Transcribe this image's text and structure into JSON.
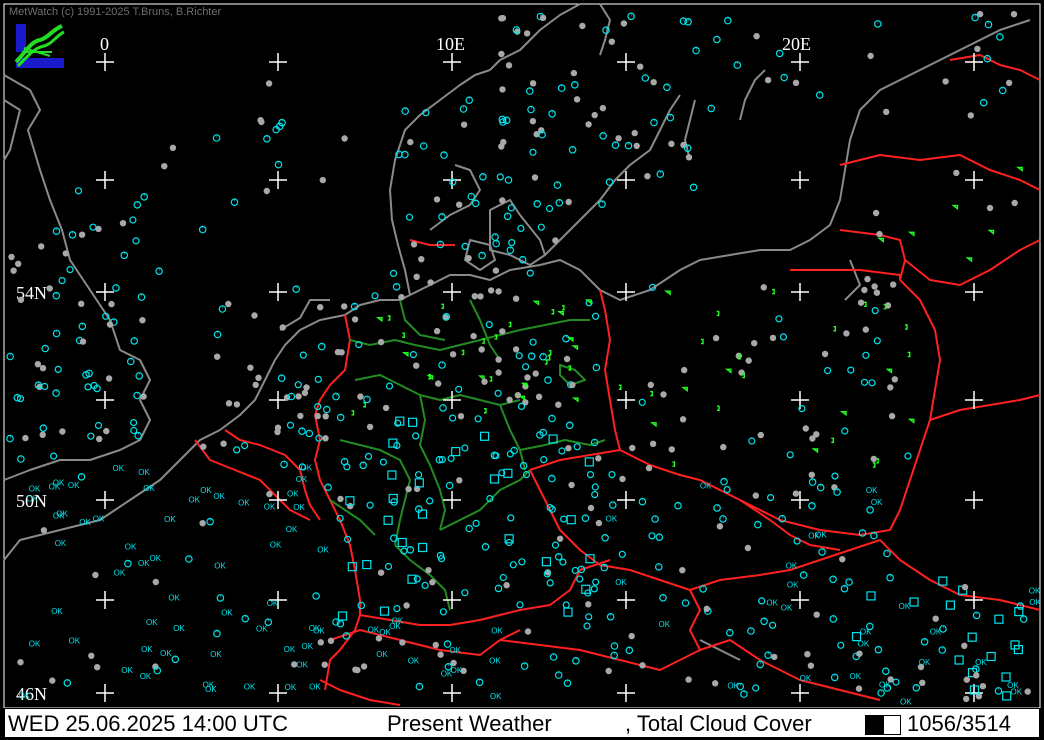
{
  "credit": "MetWatch  (c) 1991-2025 T.Bruns, B.Richter",
  "grid_labels": {
    "lon_0": "0",
    "lon_10e": "10E",
    "lon_20e": "20E",
    "lat_54n": "54N",
    "lat_50n": "50N",
    "lat_46n": "46N"
  },
  "status": {
    "datetime": "WED 25.06.2025 14:00 UTC",
    "product": "Present Weather",
    "separator_product": ", Total Cloud Cover",
    "count": "1056/3514"
  },
  "colors": {
    "background": "#000000",
    "coast": "#8a8a8a",
    "border": "#ff2020",
    "state_border": "#228b22",
    "station_cyan": "#00e5ee",
    "station_grey": "#a8a8a8",
    "weather_green": "#20ff20",
    "weather_yellow": "#ffff00",
    "ok_text": "#00e5ee"
  }
}
